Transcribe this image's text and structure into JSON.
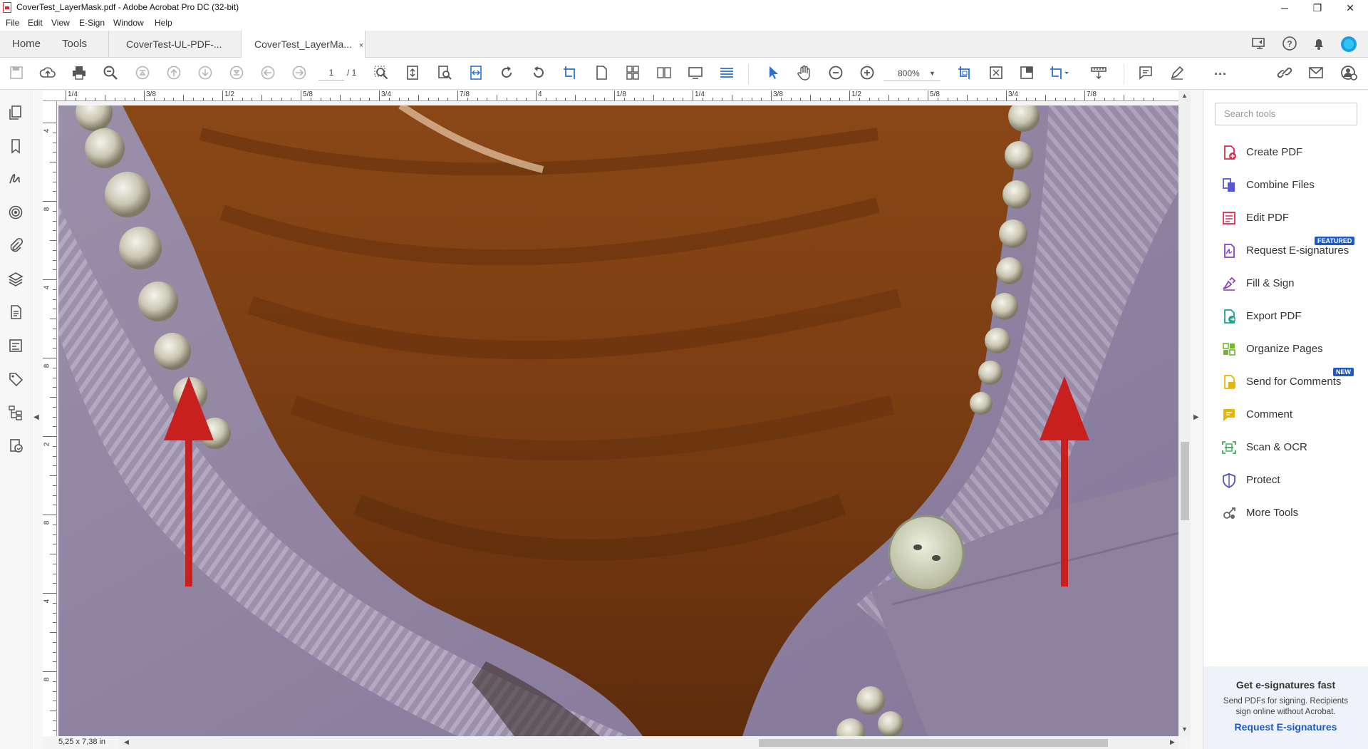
{
  "window": {
    "title": "CoverTest_LayerMask.pdf - Adobe Acrobat Pro DC (32-bit)",
    "minimize_glyph": "─",
    "restore_glyph": "❐",
    "close_glyph": "✕"
  },
  "menu": [
    "File",
    "Edit",
    "View",
    "E-Sign",
    "Window",
    "Help"
  ],
  "nav_tabs": {
    "home": "Home",
    "tools": "Tools"
  },
  "doc_tabs": [
    {
      "label": "CoverTest-UL-PDF-..."
    },
    {
      "label": "CoverTest_LayerMa...",
      "close": "×",
      "active": true
    }
  ],
  "toolbar": {
    "page_current": "1",
    "page_total": "/ 1",
    "zoom": "800%",
    "more": "···"
  },
  "ruler": {
    "horizontal_labels": [
      "1/4",
      "3/8",
      "1/2",
      "5/8",
      "3/4",
      "7/8",
      "4",
      "1/8",
      "1/4",
      "3/8",
      "1/2",
      "5/8",
      "3/4",
      "7/8"
    ],
    "vertical_labels": [
      "4",
      "8",
      "4",
      "8",
      "2",
      "8",
      "4",
      "8"
    ]
  },
  "page_size_label": "5,25 x 7,38 in",
  "tools_panel": {
    "search_placeholder": "Search tools",
    "items": [
      {
        "label": "Create PDF",
        "icon": "create-pdf-icon",
        "color": "#e0294a"
      },
      {
        "label": "Combine Files",
        "icon": "combine-files-icon",
        "color": "#5757d6"
      },
      {
        "label": "Edit PDF",
        "icon": "edit-pdf-icon",
        "color": "#e0294a"
      },
      {
        "label": "Request E-signatures",
        "icon": "request-esign-icon",
        "color": "#8a3fc9",
        "badge": "FEATURED"
      },
      {
        "label": "Fill & Sign",
        "icon": "fill-sign-icon",
        "color": "#8a3fc9"
      },
      {
        "label": "Export PDF",
        "icon": "export-pdf-icon",
        "color": "#1aa38e"
      },
      {
        "label": "Organize Pages",
        "icon": "organize-pages-icon",
        "color": "#73b532"
      },
      {
        "label": "Send for Comments",
        "icon": "send-comments-icon",
        "color": "#e8b40a",
        "badge": "NEW"
      },
      {
        "label": "Comment",
        "icon": "comment-icon",
        "color": "#e8b40a"
      },
      {
        "label": "Scan & OCR",
        "icon": "scan-ocr-icon",
        "color": "#3bab4a"
      },
      {
        "label": "Protect",
        "icon": "protect-icon",
        "color": "#4f4fbe"
      },
      {
        "label": "More Tools",
        "icon": "more-tools-icon",
        "color": "#666666"
      }
    ]
  },
  "promo": {
    "title": "Get e-signatures fast",
    "text": "Send PDFs for signing. Recipients sign online without Acrobat.",
    "link": "Request E-signatures"
  },
  "colors": {
    "accent": "#1d5ac8",
    "cardigan": "#8a7d99",
    "skin": "#7a3f14",
    "arrow": "#c8201e"
  }
}
